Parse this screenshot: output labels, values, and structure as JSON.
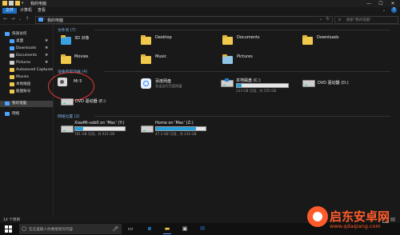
{
  "window": {
    "title": "我的电脑"
  },
  "ribbon": {
    "tabs": [
      "文件",
      "计算机",
      "查看"
    ]
  },
  "address": {
    "path": "我的电脑",
    "search_placeholder": "搜索\"我的电脑\""
  },
  "sidebar": {
    "items": [
      {
        "label": "快速访问",
        "icon": "star-icon",
        "color": "#4da3ff"
      },
      {
        "label": "桌面",
        "icon": "desktop-icon",
        "color": "#4da3ff",
        "pin": true
      },
      {
        "label": "Downloads",
        "icon": "download-icon",
        "color": "#4da3ff",
        "pin": true
      },
      {
        "label": "Documents",
        "icon": "document-icon",
        "color": "#cfcfcf",
        "pin": true
      },
      {
        "label": "Pictures",
        "icon": "picture-icon",
        "color": "#cfcfcf",
        "pin": true
      },
      {
        "label": "Autosaved Captures",
        "icon": "folder-icon",
        "color": "#f2c94c"
      },
      {
        "label": "Movies",
        "icon": "folder-icon",
        "color": "#f2c94c"
      },
      {
        "label": "本地磁盘",
        "icon": "folder-icon",
        "color": "#f2c94c"
      },
      {
        "label": "截图账号",
        "icon": "folder-icon",
        "color": "#f2c94c"
      },
      {
        "label": "我的电脑",
        "icon": "computer-icon",
        "color": "#4da3ff",
        "selected": true
      },
      {
        "label": "网络",
        "icon": "network-icon",
        "color": "#4da3ff"
      }
    ]
  },
  "sections": {
    "folders": "文件夹 (7)",
    "devices": "设备和驱动器 (4)",
    "network": "网络位置 (2)"
  },
  "folders": [
    {
      "label": "3D 对象"
    },
    {
      "label": "Desktop"
    },
    {
      "label": "Documents"
    },
    {
      "label": "Downloads"
    },
    {
      "label": "Movies"
    },
    {
      "label": "Music"
    },
    {
      "label": "Pictures"
    }
  ],
  "devices": [
    {
      "label": "Mi 5",
      "icon": "phone-camera-icon"
    },
    {
      "label": "百度网盘",
      "sub": "双击运行百度网盘",
      "icon": "baidu-netdisk-icon"
    },
    {
      "label": "本地磁盘 (C:)",
      "sub": "233 GB 可用，共 255 GB",
      "fill": 0.09,
      "icon": "drive-icon"
    },
    {
      "label": "DVD 驱动器 (D:)",
      "icon": "dvd-icon"
    },
    {
      "label": "DVD 驱动器 (E:)",
      "icon": "dvd-icon"
    }
  ],
  "network": [
    {
      "label": "XiaoMi-usb0 on 'Mac' (Y:)",
      "sub": "781 GB 可用，共 931 GB",
      "fill": 0.16
    },
    {
      "label": "Home on 'Mac' (Z:)",
      "sub": "47.3 GB 可用，共 233 GB",
      "fill": 0.8
    }
  ],
  "status": {
    "count": "14 个项目"
  },
  "taskbar": {
    "search_placeholder": "在这里输入你要搜索的内容"
  },
  "watermark": {
    "line1": "启东安卓网",
    "line2": "www.qdaqiang.com"
  },
  "colors": {
    "accent": "#1b6ec2",
    "annotation": "#e53935",
    "bar_fill": "#26a0da",
    "watermark": "#ff5a2a"
  }
}
